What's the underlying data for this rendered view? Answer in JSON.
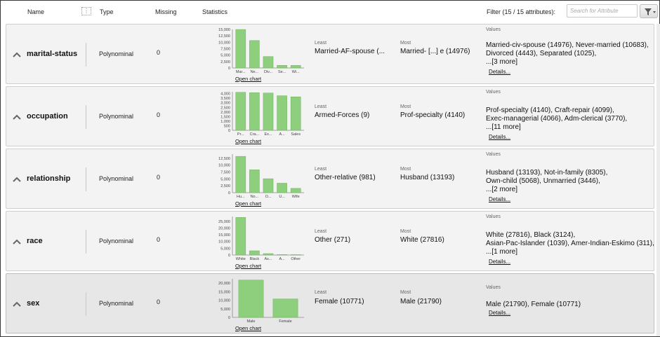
{
  "header": {
    "name": "Name",
    "type": "Type",
    "missing": "Missing",
    "statistics": "Statistics",
    "filter": "Filter (15 / 15 attributes):",
    "search_placeholder": "Search for Attribute"
  },
  "labels": {
    "least": "Least",
    "most": "Most",
    "values": "Values",
    "open_chart": "Open chart",
    "details": "Details..."
  },
  "rows": [
    {
      "name": "marital-status",
      "type": "Polynominal",
      "missing": "0",
      "least": "Married-AF-spouse (...",
      "most": "Married- [...] e (14976)",
      "values": "Married-civ-spouse (14976), Never-married (10683),\nDivorced (4443), Separated (1025),\n...[3 more]",
      "chart_data": {
        "type": "bar",
        "categories": [
          "Mar...",
          "Ne...",
          "Div...",
          "Se...",
          "Wi..."
        ],
        "values": [
          14976,
          10683,
          4443,
          1025,
          993
        ],
        "yticks": [
          "15,000",
          "12,500",
          "10,000",
          "7,500",
          "5,000",
          "2,500",
          "0"
        ],
        "ylim": [
          0,
          15000
        ]
      }
    },
    {
      "name": "occupation",
      "type": "Polynominal",
      "missing": "0",
      "least": "Armed-Forces (9)",
      "most": "Prof-specialty (4140)",
      "values": "Prof-specialty (4140), Craft-repair (4099),\nExec-managerial (4066), Adm-clerical (3770),\n...[11 more]",
      "chart_data": {
        "type": "bar",
        "categories": [
          "Pr...",
          "Cra...",
          "Ex...",
          "A...",
          "Sales"
        ],
        "values": [
          4140,
          4099,
          4066,
          3770,
          3650
        ],
        "yticks": [
          "4,000",
          "3,500",
          "3,000",
          "2,500",
          "2,000",
          "1,500",
          "1,000",
          "500",
          "0"
        ],
        "ylim": [
          0,
          4200
        ]
      }
    },
    {
      "name": "relationship",
      "type": "Polynominal",
      "missing": "0",
      "least": "Other-relative (981)",
      "most": "Husband (13193)",
      "values": "Husband (13193), Not-in-family (8305),\nOwn-child (5068), Unmarried (3446),\n...[2 more]",
      "chart_data": {
        "type": "bar",
        "categories": [
          "Hu...",
          "No...",
          "O...",
          "U...",
          "Wife"
        ],
        "values": [
          13193,
          8305,
          5068,
          3446,
          1568
        ],
        "yticks": [
          "12,500",
          "10,000",
          "7,500",
          "5,000",
          "2,500",
          "0"
        ],
        "ylim": [
          0,
          14000
        ]
      }
    },
    {
      "name": "race",
      "type": "Polynominal",
      "missing": "0",
      "least": "Other (271)",
      "most": "White (27816)",
      "values": "White (27816), Black (3124),\nAsian-Pac-Islander (1039), Amer-Indian-Eskimo (311),\n...[1 more]",
      "chart_data": {
        "type": "bar",
        "categories": [
          "White",
          "Black",
          "As...",
          "A...",
          "Other"
        ],
        "values": [
          27816,
          3124,
          1039,
          311,
          271
        ],
        "yticks": [
          "25,000",
          "20,000",
          "15,000",
          "10,000",
          "5,000",
          "0"
        ],
        "ylim": [
          0,
          28500
        ]
      }
    },
    {
      "name": "sex",
      "type": "Polynominal",
      "missing": "0",
      "least": "Female (10771)",
      "most": "Male (21790)",
      "values": "Male (21790), Female (10771)",
      "chart_data": {
        "type": "bar",
        "categories": [
          "Male",
          "Female"
        ],
        "values": [
          21790,
          10771
        ],
        "yticks": [
          "20,000",
          "15,000",
          "10,000",
          "5,000",
          "0"
        ],
        "ylim": [
          0,
          22500
        ]
      }
    }
  ],
  "colors": {
    "bar": "#8ecf7e",
    "bar_stroke": "#6fb35e",
    "row_bg": "#f3f3f3",
    "selected_row_bg": "#e7e7e7"
  }
}
